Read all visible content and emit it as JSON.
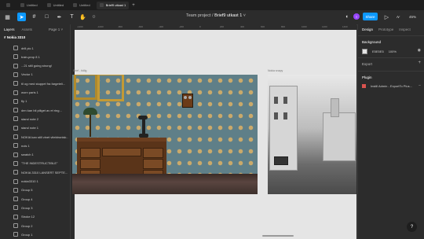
{
  "tabs": [
    {
      "label": "Untitled",
      "active": false
    },
    {
      "label": "Untitled",
      "active": false
    },
    {
      "label": "Untitled",
      "active": false
    },
    {
      "label": "Brief9 utkast 1",
      "active": true
    }
  ],
  "toolbar": {
    "project": "Team project",
    "separator": "/",
    "file_name": "Brief9 utkast 1",
    "avatar_letter": "I",
    "share_label": "Share",
    "zoom": "45%"
  },
  "left_panel": {
    "tabs": [
      "Layers",
      "Assets"
    ],
    "page_label": "Page 1",
    "frame_name": "Nokia 3310",
    "layers": [
      "drill pic 1",
      "train-prop 8 1",
      "...21 still going strong!",
      "Vector 1",
      "til og med stuppet fra fargeteli...",
      "worn paris 1",
      "fly 1",
      "den kan bli piliget av et ring...",
      "stand note 2",
      "stand note 1",
      "NOKIA kan still vinet vitektronisk...",
      "nois 1",
      "swatch 1",
      "\"THE INDESTRUCTIBLE\"",
      "NOKIA 3310 LANSERT SEPTE...",
      "nokia3310 1",
      "Group 5",
      "Group 4",
      "Group 3",
      "Stroke 12",
      "Group 2",
      "Group 1"
    ]
  },
  "canvas": {
    "ruler_marks": [
      "-1200",
      "-1000",
      "-800",
      "-600",
      "-400",
      "-200",
      "0",
      "200",
      "400",
      "600",
      "800",
      "1000",
      "1200",
      "1400"
    ],
    "frame1_label": "Brief - tidlig",
    "frame2_label": "Nokia snapy"
  },
  "right_panel": {
    "tabs": [
      "Design",
      "Prototype",
      "Inspect"
    ],
    "background_title": "Background",
    "background_hex": "E5E5E5",
    "background_opacity": "100%",
    "export_title": "Export",
    "plugin_title": "Plugin",
    "plugin_name": "Instill Admin - ExportTo Plus..."
  },
  "help_label": "?"
}
